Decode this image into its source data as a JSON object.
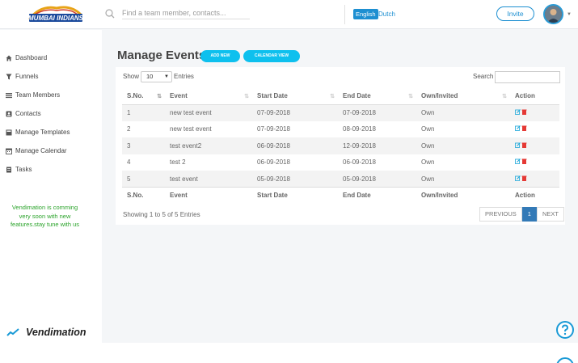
{
  "header": {
    "logo_alt": "MUMBAI INDIANS",
    "search_placeholder": "Find a team member, contacts...",
    "lang_active": "English",
    "lang_other": "Dutch",
    "invite_label": "Invite"
  },
  "sidebar": {
    "items": [
      {
        "label": "Dashboard",
        "icon": "home-icon"
      },
      {
        "label": "Funnels",
        "icon": "funnel-icon"
      },
      {
        "label": "Team Members",
        "icon": "list-icon"
      },
      {
        "label": "Contacts",
        "icon": "contact-card-icon"
      },
      {
        "label": "Manage Templates",
        "icon": "template-icon"
      },
      {
        "label": "Manage Calendar",
        "icon": "calendar-icon"
      },
      {
        "label": "Tasks",
        "icon": "task-icon"
      }
    ],
    "promo": "Vendimation is comming very soon with new features.stay tune with us",
    "brand": "Vendimation"
  },
  "main": {
    "title": "Manage Events",
    "add_new_label": "ADD NEW",
    "calendar_view_label": "CALENDAR VIEW",
    "show_label": "Show",
    "show_value": "10",
    "entries_label": "Entries",
    "search_label": "Search",
    "columns": [
      "S.No.",
      "Event",
      "Start Date",
      "End Date",
      "Own/Invited",
      "Action"
    ],
    "rows": [
      {
        "sno": "1",
        "event": "new test event",
        "start": "07-09-2018",
        "end": "07-09-2018",
        "own": "Own"
      },
      {
        "sno": "2",
        "event": "new test event",
        "start": "07-09-2018",
        "end": "08-09-2018",
        "own": "Own"
      },
      {
        "sno": "3",
        "event": "test event2",
        "start": "06-09-2018",
        "end": "12-09-2018",
        "own": "Own"
      },
      {
        "sno": "4",
        "event": "test 2",
        "start": "06-09-2018",
        "end": "06-09-2018",
        "own": "Own"
      },
      {
        "sno": "5",
        "event": "test event",
        "start": "05-09-2018",
        "end": "05-09-2018",
        "own": "Own"
      }
    ],
    "info": "Showing 1 to 5 of 5 Entries",
    "pager": {
      "previous": "PREVIOUS",
      "page": "1",
      "next": "NEXT"
    }
  },
  "colors": {
    "accent": "#1d8fd1",
    "cyan": "#0ec0ee",
    "green": "#2aa32a",
    "delete": "#e53935",
    "edit": "#1aa6d9"
  }
}
